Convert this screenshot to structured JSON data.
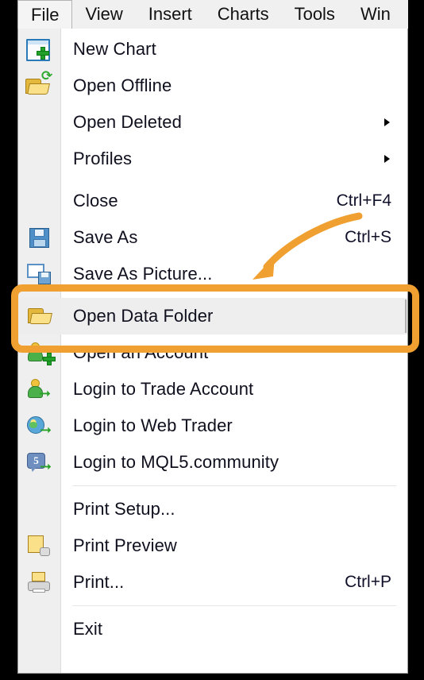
{
  "app": {
    "accent_orange": "#F0A030",
    "menu_bg": "#FFFFFF",
    "gutter_bg": "#EFEFEF",
    "highlight_bg": "#EEEEEE"
  },
  "menubar": {
    "items": [
      {
        "label": "File",
        "active": true
      },
      {
        "label": "View",
        "active": false
      },
      {
        "label": "Insert",
        "active": false
      },
      {
        "label": "Charts",
        "active": false
      },
      {
        "label": "Tools",
        "active": false
      },
      {
        "label": "Win",
        "active": false
      }
    ]
  },
  "file_menu": {
    "items": [
      {
        "label": "New Chart",
        "accel": "",
        "icon": "new-chart-icon",
        "submenu": false,
        "highlighted": false
      },
      {
        "label": "Open Offline",
        "accel": "",
        "icon": "open-offline-folder-icon",
        "submenu": false,
        "highlighted": false
      },
      {
        "label": "Open Deleted",
        "accel": "",
        "icon": "",
        "submenu": true,
        "highlighted": false
      },
      {
        "label": "Profiles",
        "accel": "",
        "icon": "",
        "submenu": true,
        "highlighted": false
      },
      {
        "label": "Close",
        "accel": "Ctrl+F4",
        "icon": "",
        "submenu": false,
        "highlighted": false
      },
      {
        "label": "Save As",
        "accel": "Ctrl+S",
        "icon": "floppy-disk-icon",
        "submenu": false,
        "highlighted": false
      },
      {
        "label": "Save As Picture...",
        "accel": "",
        "icon": "save-as-picture-icon",
        "submenu": false,
        "highlighted": false
      },
      {
        "label": "Open Data Folder",
        "accel": "",
        "icon": "open-folder-icon",
        "submenu": false,
        "highlighted": true
      },
      {
        "label": "Open an Account",
        "accel": "",
        "icon": "account-add-icon",
        "submenu": false,
        "highlighted": false
      },
      {
        "label": "Login to Trade Account",
        "accel": "",
        "icon": "account-login-icon",
        "submenu": false,
        "highlighted": false
      },
      {
        "label": "Login to Web Trader",
        "accel": "",
        "icon": "globe-login-icon",
        "submenu": false,
        "highlighted": false
      },
      {
        "label": "Login to MQL5.community",
        "accel": "",
        "icon": "mql5-community-icon",
        "submenu": false,
        "highlighted": false
      },
      {
        "label": "Print Setup...",
        "accel": "",
        "icon": "",
        "submenu": false,
        "highlighted": false
      },
      {
        "label": "Print Preview",
        "accel": "",
        "icon": "print-preview-icon",
        "submenu": false,
        "highlighted": false
      },
      {
        "label": "Print...",
        "accel": "Ctrl+P",
        "icon": "printer-icon",
        "submenu": false,
        "highlighted": false
      },
      {
        "label": "Exit",
        "accel": "",
        "icon": "",
        "submenu": false,
        "highlighted": false
      }
    ]
  },
  "annotation": {
    "highlight_target": "Open Data Folder",
    "shape": "rounded-rectangle",
    "arrow": "curved-arrow-pointing-down-left",
    "color": "#F0A030"
  }
}
